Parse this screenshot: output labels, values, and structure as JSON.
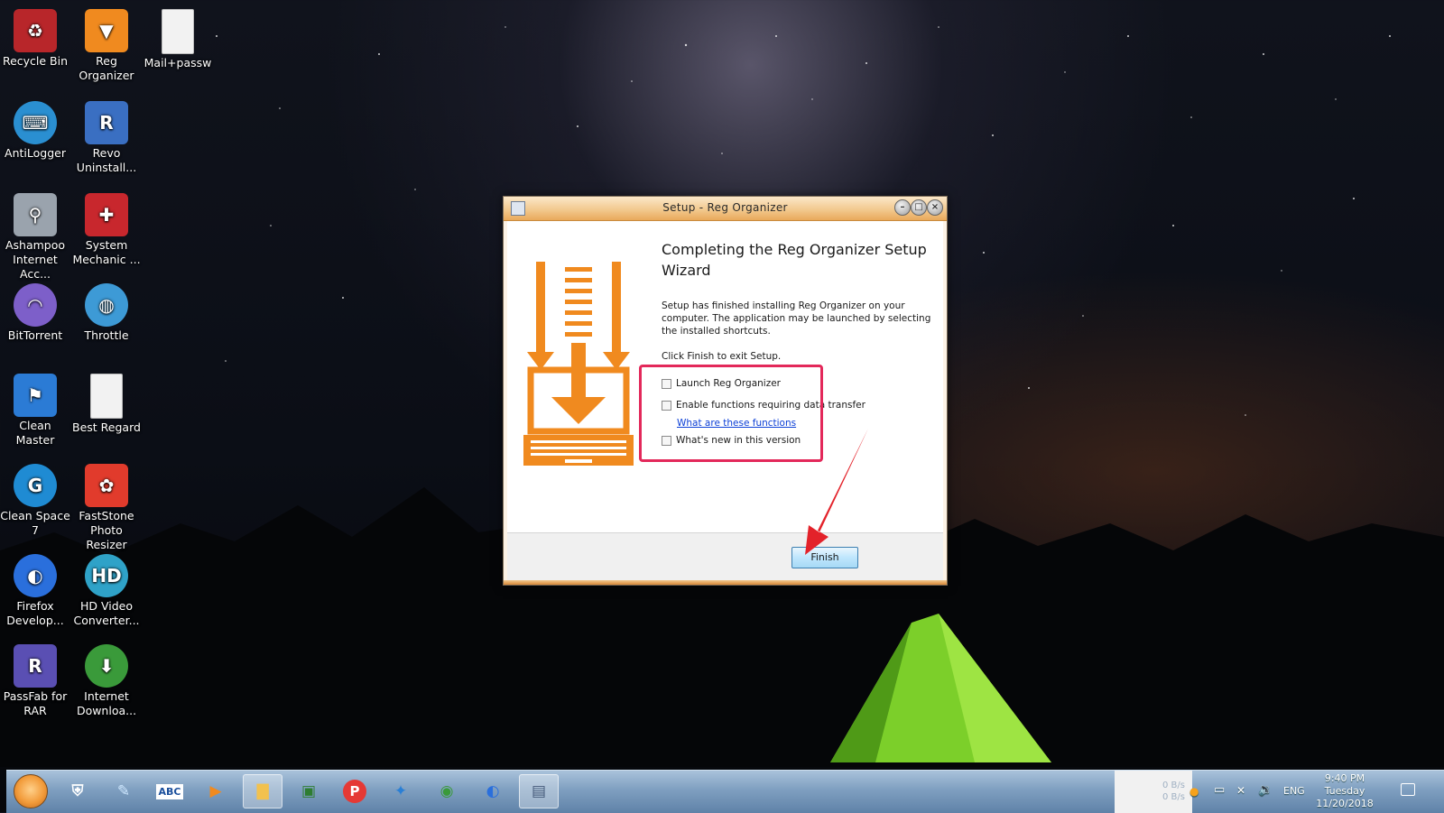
{
  "desktop": {
    "icons": [
      {
        "label": "Recycle Bin",
        "icon": "recycle-bin-icon",
        "color": "#b8262a"
      },
      {
        "label": "Reg Organizer",
        "icon": "reg-organizer-icon",
        "color": "#f08a1f"
      },
      {
        "label": "Mail+passw",
        "icon": "text-file-icon",
        "color": "#f2f2f2"
      },
      {
        "label": "AntiLogger",
        "icon": "antilogger-icon",
        "color": "#2a8fd1"
      },
      {
        "label": "Revo Uninstall...",
        "icon": "revo-uninstaller-icon",
        "color": "#3a6fc2"
      },
      {
        "label": "Ashampoo Internet Acc...",
        "icon": "ashampoo-icon",
        "color": "#9aa3ad"
      },
      {
        "label": "System Mechanic ...",
        "icon": "system-mechanic-icon",
        "color": "#c8272d"
      },
      {
        "label": "BitTorrent",
        "icon": "bittorrent-icon",
        "color": "#7d5fc9"
      },
      {
        "label": "Throttle",
        "icon": "throttle-icon",
        "color": "#3d9ad6"
      },
      {
        "label": "Clean Master",
        "icon": "clean-master-icon",
        "color": "#2b7bd5"
      },
      {
        "label": "Best Regard",
        "icon": "text-file-icon",
        "color": "#f2f2f2"
      },
      {
        "label": "Clean Space 7",
        "icon": "clean-space-icon",
        "color": "#1f8bd3"
      },
      {
        "label": "FastStone Photo Resizer",
        "icon": "faststone-icon",
        "color": "#e13b2c"
      },
      {
        "label": "Firefox Develop...",
        "icon": "firefox-icon",
        "color": "#2a6fdc"
      },
      {
        "label": "HD Video Converter...",
        "icon": "hd-video-converter-icon",
        "color": "#2fa2c8"
      },
      {
        "label": "PassFab for RAR",
        "icon": "passfab-icon",
        "color": "#5a4fb3"
      },
      {
        "label": "Internet Downloa...",
        "icon": "internet-download-manager-icon",
        "color": "#3a9a3a"
      }
    ]
  },
  "window": {
    "title": "Setup - Reg Organizer",
    "heading": "Completing the Reg Organizer Setup Wizard",
    "paragraph1": "Setup has finished installing Reg Organizer on your computer. The application may be launched by selecting the installed shortcuts.",
    "paragraph2": "Click Finish to exit Setup.",
    "options": {
      "launch": {
        "label": "Launch Reg Organizer",
        "checked": false
      },
      "data_transfer": {
        "label": "Enable functions requiring data transfer",
        "checked": false
      },
      "whats_new": {
        "label": "What's new in this version",
        "checked": false
      }
    },
    "link": "What are these functions",
    "finish_label": "Finish",
    "accent": "#f08a1f",
    "highlight_color": "#e3285a"
  },
  "taskbar": {
    "apps": [
      {
        "icon": "shield-icon",
        "glyph": "⛨",
        "color": "#ffffff"
      },
      {
        "icon": "pen-icon",
        "glyph": "✎",
        "color": "#cfe8ff"
      },
      {
        "icon": "abc-icon",
        "glyph": "ABC",
        "color": "#1b4f9c"
      },
      {
        "icon": "media-player-icon",
        "glyph": "▶",
        "color": "#f08a1f"
      },
      {
        "icon": "file-explorer-icon",
        "glyph": "▇",
        "color": "#f2c14e"
      },
      {
        "icon": "screenshot-tool-icon",
        "glyph": "▣",
        "color": "#2e7d32"
      },
      {
        "icon": "p-app-icon",
        "glyph": "P",
        "color": "#e53935"
      },
      {
        "icon": "network-app-icon",
        "glyph": "✦",
        "color": "#2a7fd5"
      },
      {
        "icon": "internet-download-manager-icon",
        "glyph": "◉",
        "color": "#3a9a3a"
      },
      {
        "icon": "firefox-icon",
        "glyph": "◐",
        "color": "#2a6fdc"
      },
      {
        "icon": "setup-icon",
        "glyph": "▤",
        "color": "#455a7a"
      }
    ],
    "net_up": "0 B/s",
    "net_down": "0 B/s",
    "language": "ENG",
    "time": "9:40 PM",
    "day": "Tuesday",
    "date": "11/20/2018"
  }
}
